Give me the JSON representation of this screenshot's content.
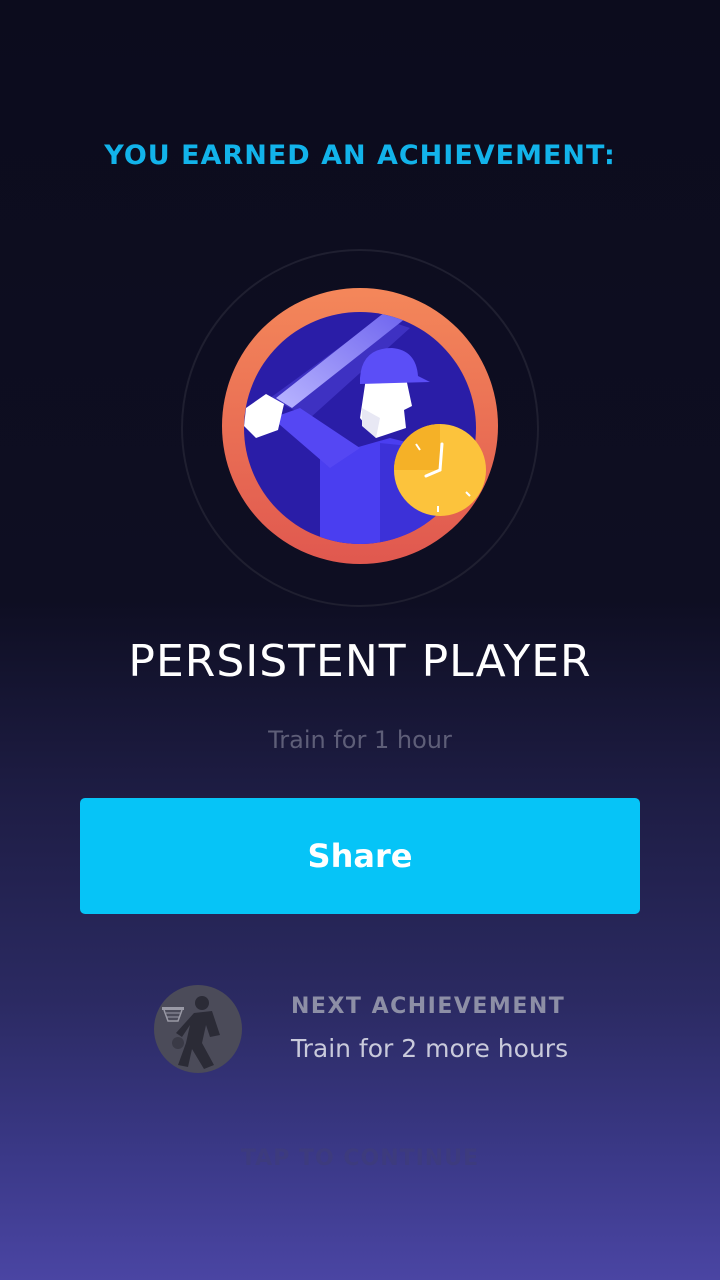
{
  "header": {
    "title": "YOU EARNED AN ACHIEVEMENT:"
  },
  "badge": {
    "icon": "baseball-batter-clock-icon",
    "ring_color": "#ee6a55",
    "inner_color": "#2e1fae",
    "clock_color": "#fcc33c"
  },
  "achievement": {
    "title": "PERSISTENT PLAYER",
    "description": "Train for 1 hour"
  },
  "share_button": {
    "label": "Share",
    "color": "#06c4f7"
  },
  "next_achievement": {
    "icon": "basketball-player-icon",
    "label": "NEXT ACHIEVEMENT",
    "description": "Train for 2 more hours"
  },
  "footer": {
    "continue_label": "TAP TO CONTINUE"
  }
}
